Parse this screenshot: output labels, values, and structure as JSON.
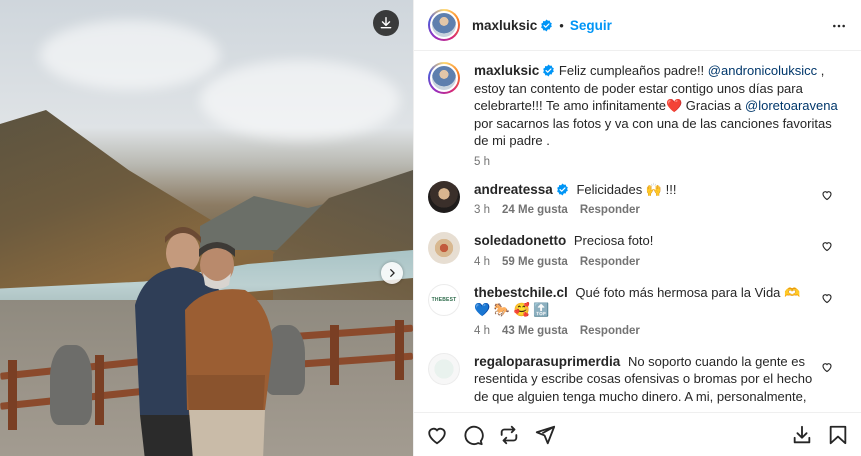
{
  "post_author": {
    "username": "maxluksic",
    "follow_label": "Seguir"
  },
  "caption": {
    "username": "maxluksic",
    "text_1": "Feliz cumpleaños padre!! ",
    "mention_1": "@andronicoluksicc",
    "text_2": " , estoy tan contento de poder estar contigo unos días para celebrarte!!! Te amo infinitamente",
    "emoji_1": "❤️",
    "text_3": " Gracias a ",
    "mention_2": "@loretoaravena",
    "text_4": " por sacarnos las fotos y va con una de las canciones favoritas de mi padre .",
    "time": "5 h"
  },
  "comments": [
    {
      "username": "andreatessa",
      "verified": true,
      "text": "Felicidades 🙌 !!!",
      "time": "3 h",
      "likes": "24 Me gusta",
      "reply": "Responder"
    },
    {
      "username": "soledadonetto",
      "verified": false,
      "text": "Preciosa foto!",
      "time": "4 h",
      "likes": "59 Me gusta",
      "reply": "Responder"
    },
    {
      "username": "thebestchile.cl",
      "verified": false,
      "text": "Qué foto más hermosa para la Vida 🫶 💙 🐎 🥰 🔝",
      "time": "4 h",
      "likes": "43 Me gusta",
      "reply": "Responder"
    },
    {
      "username": "regaloparasuprimerdia",
      "verified": false,
      "text": "No soporto cuando la gente es resentida y escribe cosas ofensivas o bromas por el hecho de que alguien tenga mucho dinero.  A mi, personalmente, me",
      "time": "",
      "likes": "",
      "reply": ""
    }
  ],
  "thebestchile_avatar_text": "THEBEST",
  "icons": {
    "download": "download-icon",
    "next": "chevron-right-icon",
    "more": "more-horizontal-icon",
    "like": "heart-icon",
    "comment": "comment-icon",
    "share": "repost-icon",
    "send": "send-icon",
    "save": "bookmark-icon"
  },
  "colors": {
    "accent": "#0095f6",
    "verified": "#0095f6",
    "mention": "#00376b",
    "secondary_text": "#737373"
  }
}
